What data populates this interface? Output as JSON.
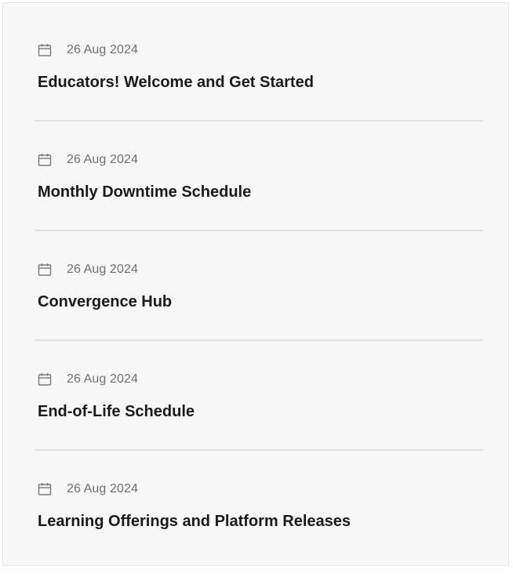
{
  "announcements": [
    {
      "date": "26 Aug 2024",
      "title": "Educators! Welcome and Get Started"
    },
    {
      "date": "26 Aug 2024",
      "title": "Monthly Downtime Schedule"
    },
    {
      "date": "26 Aug 2024",
      "title": "Convergence Hub"
    },
    {
      "date": "26 Aug 2024",
      "title": "End-of-Life Schedule"
    },
    {
      "date": "26 Aug 2024",
      "title": "Learning Offerings and Platform Releases"
    }
  ],
  "icons": {
    "date": "calendar-icon"
  },
  "colors": {
    "panel_background": "#f7f7f7",
    "date_text": "#6f6f6f",
    "title_text": "#1a1a1a",
    "divider": "#e3e3e3"
  }
}
